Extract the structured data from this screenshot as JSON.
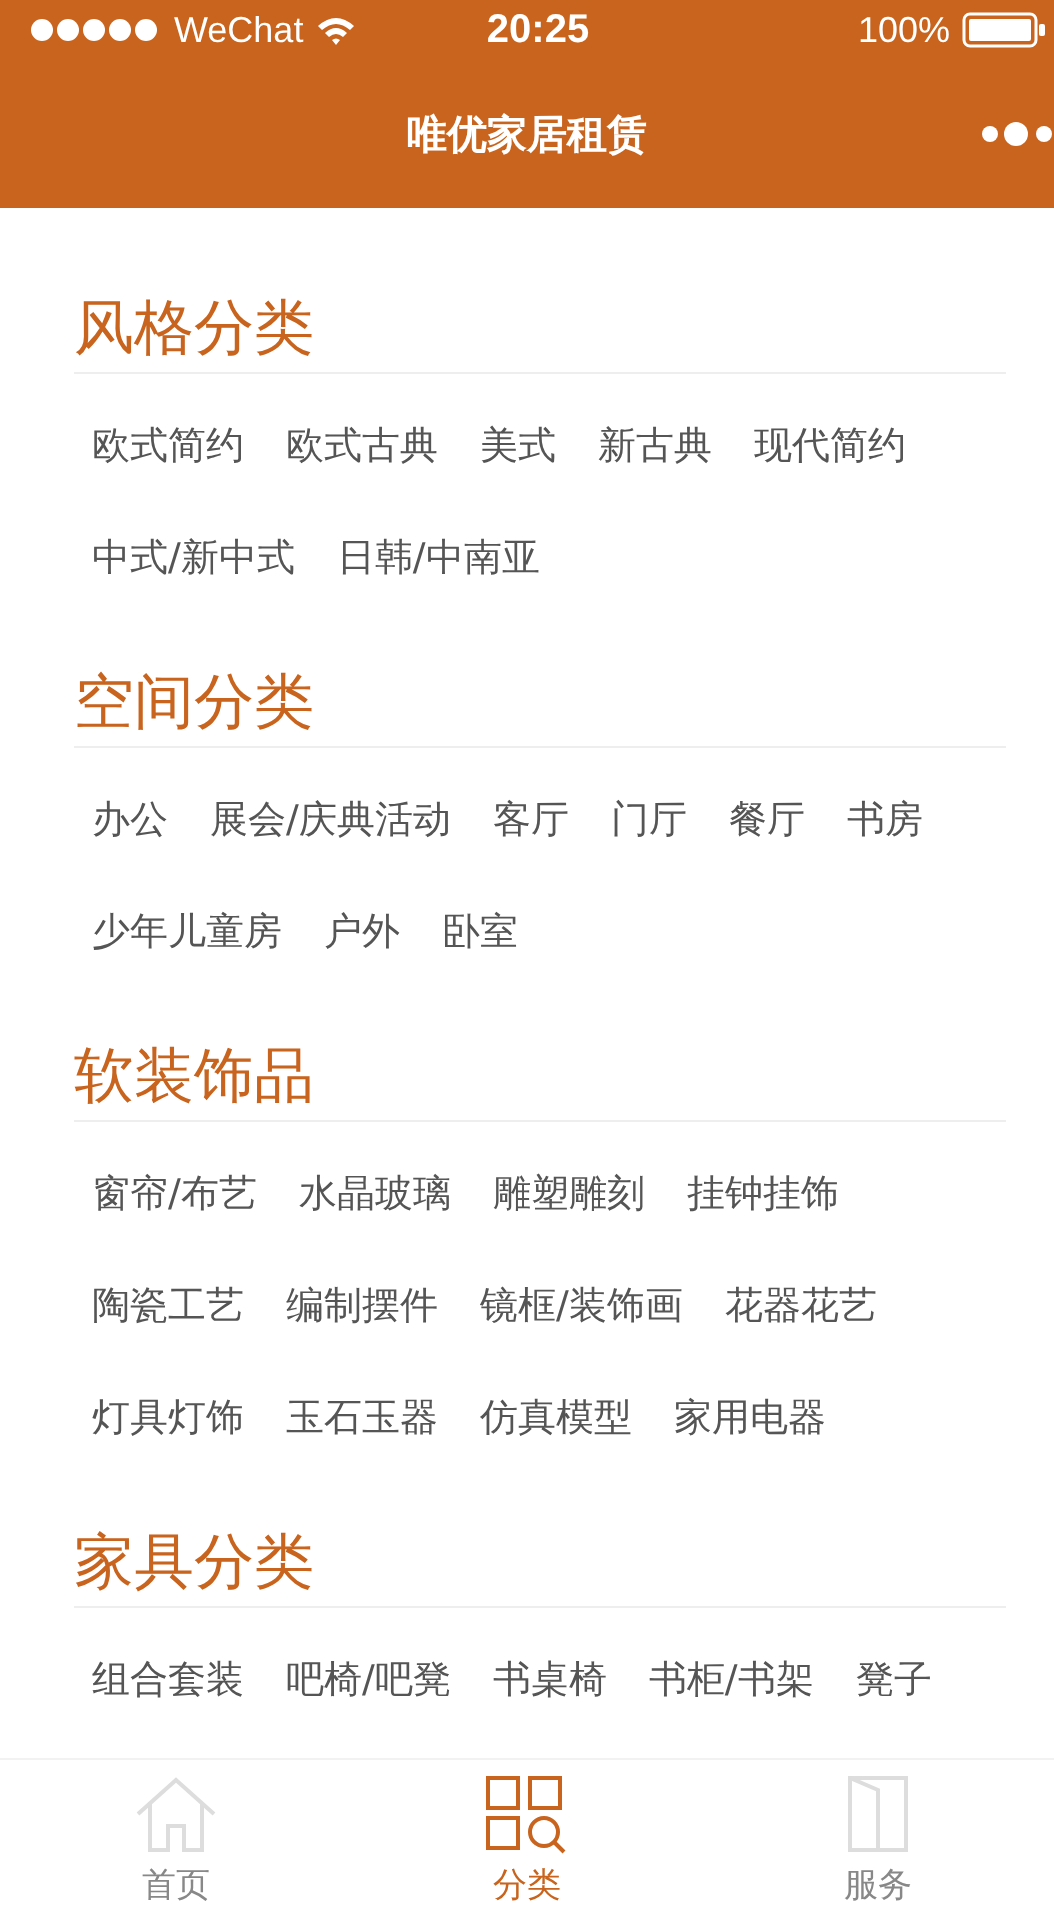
{
  "status_bar": {
    "carrier": "WeChat",
    "time": "20:25",
    "battery": "100%"
  },
  "nav_bar": {
    "title": "唯优家居租赁"
  },
  "sections": [
    {
      "title": "风格分类",
      "tags": [
        "欧式简约",
        "欧式古典",
        "美式",
        "新古典",
        "现代简约",
        "中式/新中式",
        "日韩/中南亚"
      ]
    },
    {
      "title": "空间分类",
      "tags": [
        "办公",
        "展会/庆典活动",
        "客厅",
        "门厅",
        "餐厅",
        "书房",
        "少年儿童房",
        "户外",
        "卧室"
      ]
    },
    {
      "title": "软装饰品",
      "tags": [
        "窗帘/布艺",
        "水晶玻璃",
        "雕塑雕刻",
        "挂钟挂饰",
        "陶瓷工艺",
        "编制摆件",
        "镜框/装饰画",
        "花器花艺",
        "灯具灯饰",
        "玉石玉器",
        "仿真模型",
        "家用电器"
      ]
    },
    {
      "title": "家具分类",
      "tags": [
        "组合套装",
        "吧椅/吧凳",
        "书桌椅",
        "书柜/书架",
        "凳子"
      ]
    }
  ],
  "tab_bar": [
    {
      "kind": "home",
      "label": "首页",
      "selected": false
    },
    {
      "kind": "category",
      "label": "分类",
      "selected": true
    },
    {
      "kind": "service",
      "label": "服务",
      "selected": false
    }
  ]
}
